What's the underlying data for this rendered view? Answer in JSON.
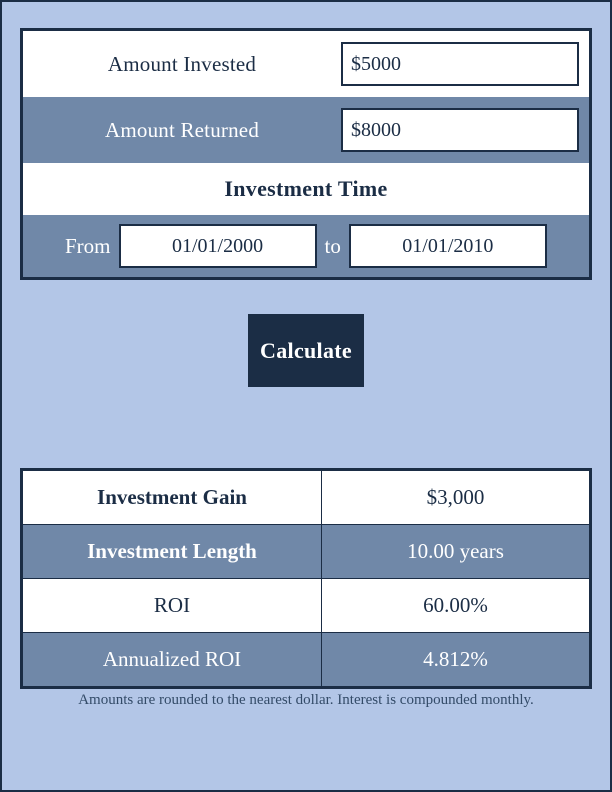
{
  "form": {
    "amount_invested": {
      "label": "Amount Invested",
      "value": "$5000",
      "placeholder": "$5000"
    },
    "amount_returned": {
      "label": "Amount Returned",
      "value": "$8000",
      "placeholder": "$8000"
    },
    "investment_time": {
      "header": "Investment Time",
      "from_label": "From",
      "from_value": "01/01/2000",
      "to_label": "to",
      "to_value": "01/01/2010"
    }
  },
  "actions": {
    "calculate_label": "Calculate"
  },
  "results": {
    "rows": [
      {
        "label": "Investment Gain",
        "value": "$3,000"
      },
      {
        "label": "Investment Length",
        "value": "10.00 years"
      },
      {
        "label": "ROI",
        "value": "60.00%"
      },
      {
        "label": "Annualized ROI",
        "value": "4.812%"
      }
    ]
  },
  "footnote": "Amounts are rounded to the nearest dollar. Interest is compounded monthly.",
  "colors": {
    "page_background": "#b3c6e7",
    "accent_dark": "#1b2d45",
    "row_slate": "#7088a8",
    "row_white": "#ffffff"
  }
}
